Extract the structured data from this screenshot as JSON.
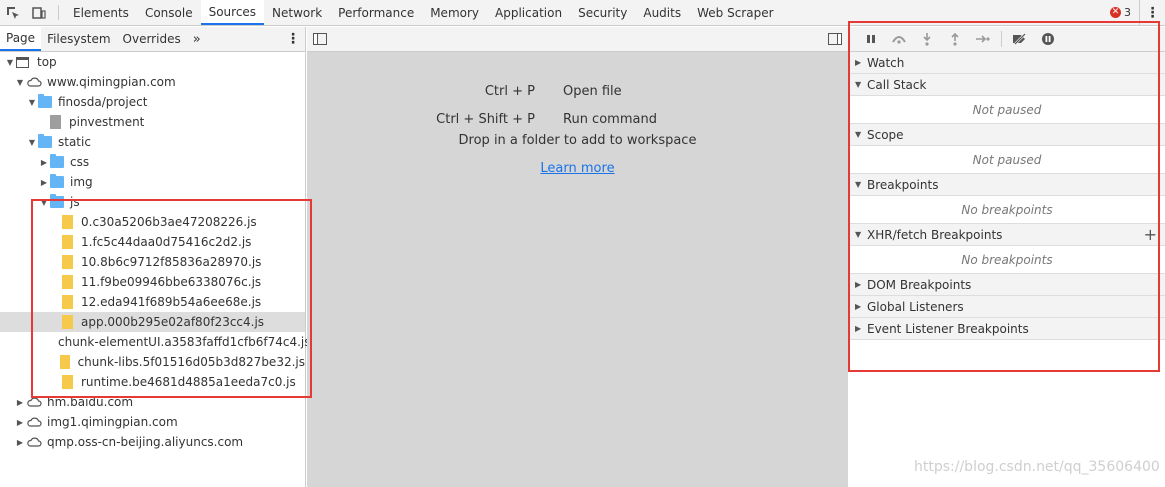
{
  "toolbar": {
    "tabs": [
      "Elements",
      "Console",
      "Sources",
      "Network",
      "Performance",
      "Memory",
      "Application",
      "Security",
      "Audits",
      "Web Scraper"
    ],
    "active_tab": "Sources",
    "error_count": "3"
  },
  "navigator": {
    "subtabs": [
      "Page",
      "Filesystem",
      "Overrides"
    ],
    "more": "»"
  },
  "tree": [
    {
      "label": "top",
      "depth": 0,
      "icon": "frame",
      "arrow": "down"
    },
    {
      "label": "www.qimingpian.com",
      "depth": 1,
      "icon": "cloud",
      "arrow": "down"
    },
    {
      "label": "finosda/project",
      "depth": 2,
      "icon": "folder",
      "arrow": "down"
    },
    {
      "label": "pinvestment",
      "depth": 3,
      "icon": "file-gray",
      "arrow": "none"
    },
    {
      "label": "static",
      "depth": 2,
      "icon": "folder",
      "arrow": "down"
    },
    {
      "label": "css",
      "depth": 3,
      "icon": "folder",
      "arrow": "right"
    },
    {
      "label": "img",
      "depth": 3,
      "icon": "folder",
      "arrow": "right"
    },
    {
      "label": "js",
      "depth": 3,
      "icon": "folder",
      "arrow": "down"
    },
    {
      "label": "0.c30a5206b3ae47208226.js",
      "depth": 4,
      "icon": "file",
      "arrow": "none"
    },
    {
      "label": "1.fc5c44daa0d75416c2d2.js",
      "depth": 4,
      "icon": "file",
      "arrow": "none"
    },
    {
      "label": "10.8b6c9712f85836a28970.js",
      "depth": 4,
      "icon": "file",
      "arrow": "none"
    },
    {
      "label": "11.f9be09946bbe6338076c.js",
      "depth": 4,
      "icon": "file",
      "arrow": "none"
    },
    {
      "label": "12.eda941f689b54a6ee68e.js",
      "depth": 4,
      "icon": "file",
      "arrow": "none"
    },
    {
      "label": "app.000b295e02af80f23cc4.js",
      "depth": 4,
      "icon": "file",
      "arrow": "none",
      "selected": true
    },
    {
      "label": "chunk-elementUI.a3583faffd1cfb6f74c4.js",
      "depth": 4,
      "icon": "file",
      "arrow": "none"
    },
    {
      "label": "chunk-libs.5f01516d05b3d827be32.js",
      "depth": 4,
      "icon": "file",
      "arrow": "none"
    },
    {
      "label": "runtime.be4681d4885a1eeda7c0.js",
      "depth": 4,
      "icon": "file",
      "arrow": "none"
    },
    {
      "label": "hm.baidu.com",
      "depth": 1,
      "icon": "cloud",
      "arrow": "right"
    },
    {
      "label": "img1.qimingpian.com",
      "depth": 1,
      "icon": "cloud",
      "arrow": "right"
    },
    {
      "label": "qmp.oss-cn-beijing.aliyuncs.com",
      "depth": 1,
      "icon": "cloud",
      "arrow": "right"
    }
  ],
  "editor": {
    "shortcuts": [
      {
        "key": "Ctrl + P",
        "action": "Open file"
      },
      {
        "key": "Ctrl + Shift + P",
        "action": "Run command"
      }
    ],
    "drop_text": "Drop in a folder to add to workspace",
    "learn_more": "Learn more"
  },
  "debugger": {
    "sections": [
      {
        "title": "Watch",
        "open": false
      },
      {
        "title": "Call Stack",
        "open": true,
        "body": "Not paused"
      },
      {
        "title": "Scope",
        "open": true,
        "body": "Not paused"
      },
      {
        "title": "Breakpoints",
        "open": true,
        "body": "No breakpoints"
      },
      {
        "title": "XHR/fetch Breakpoints",
        "open": true,
        "body": "No breakpoints",
        "plus": "+"
      },
      {
        "title": "DOM Breakpoints",
        "open": false
      },
      {
        "title": "Global Listeners",
        "open": false
      },
      {
        "title": "Event Listener Breakpoints",
        "open": false
      }
    ]
  },
  "watermark": "https://blog.csdn.net/qq_35606400",
  "colors": {
    "accent": "#1a73e8",
    "highlight_box": "#e53935",
    "folder": "#64b5f6",
    "file": "#f6c94a"
  }
}
